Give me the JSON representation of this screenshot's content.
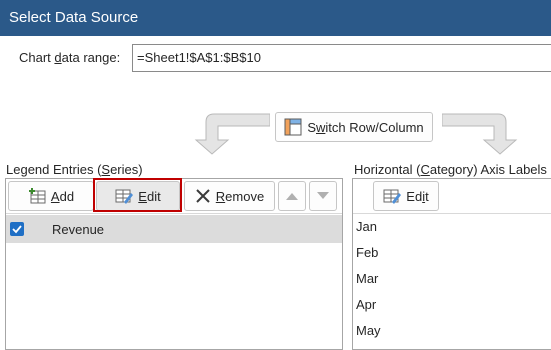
{
  "window": {
    "title": "Select Data Source"
  },
  "range": {
    "label_pre": "Chart ",
    "label_u": "d",
    "label_post": "ata range:",
    "value": "=Sheet1!$A$1:$B$10"
  },
  "switch_button": {
    "label_u": "w",
    "label_pre": "S",
    "label_post": "itch Row/Column"
  },
  "legend": {
    "label_pre": "Legend Entries (",
    "label_u": "S",
    "label_post": "eries)",
    "buttons": {
      "add_u": "A",
      "add_post": "dd",
      "edit_u": "E",
      "edit_post": "dit",
      "remove_u": "R",
      "remove_post": "emove"
    },
    "series": [
      {
        "name": "Revenue",
        "checked": true
      }
    ]
  },
  "axis": {
    "label_pre": "Horizontal (",
    "label_u": "C",
    "label_post": "ategory) Axis Labels",
    "edit_pre": "Ed",
    "edit_u": "i",
    "edit_post": "t",
    "items": [
      "Jan",
      "Feb",
      "Mar",
      "Apr",
      "May"
    ]
  },
  "colors": {
    "titlebar": "#2b5989",
    "highlight": "#c00000",
    "checkbox": "#1f6fc5",
    "selected_row": "#dcdcdc"
  }
}
